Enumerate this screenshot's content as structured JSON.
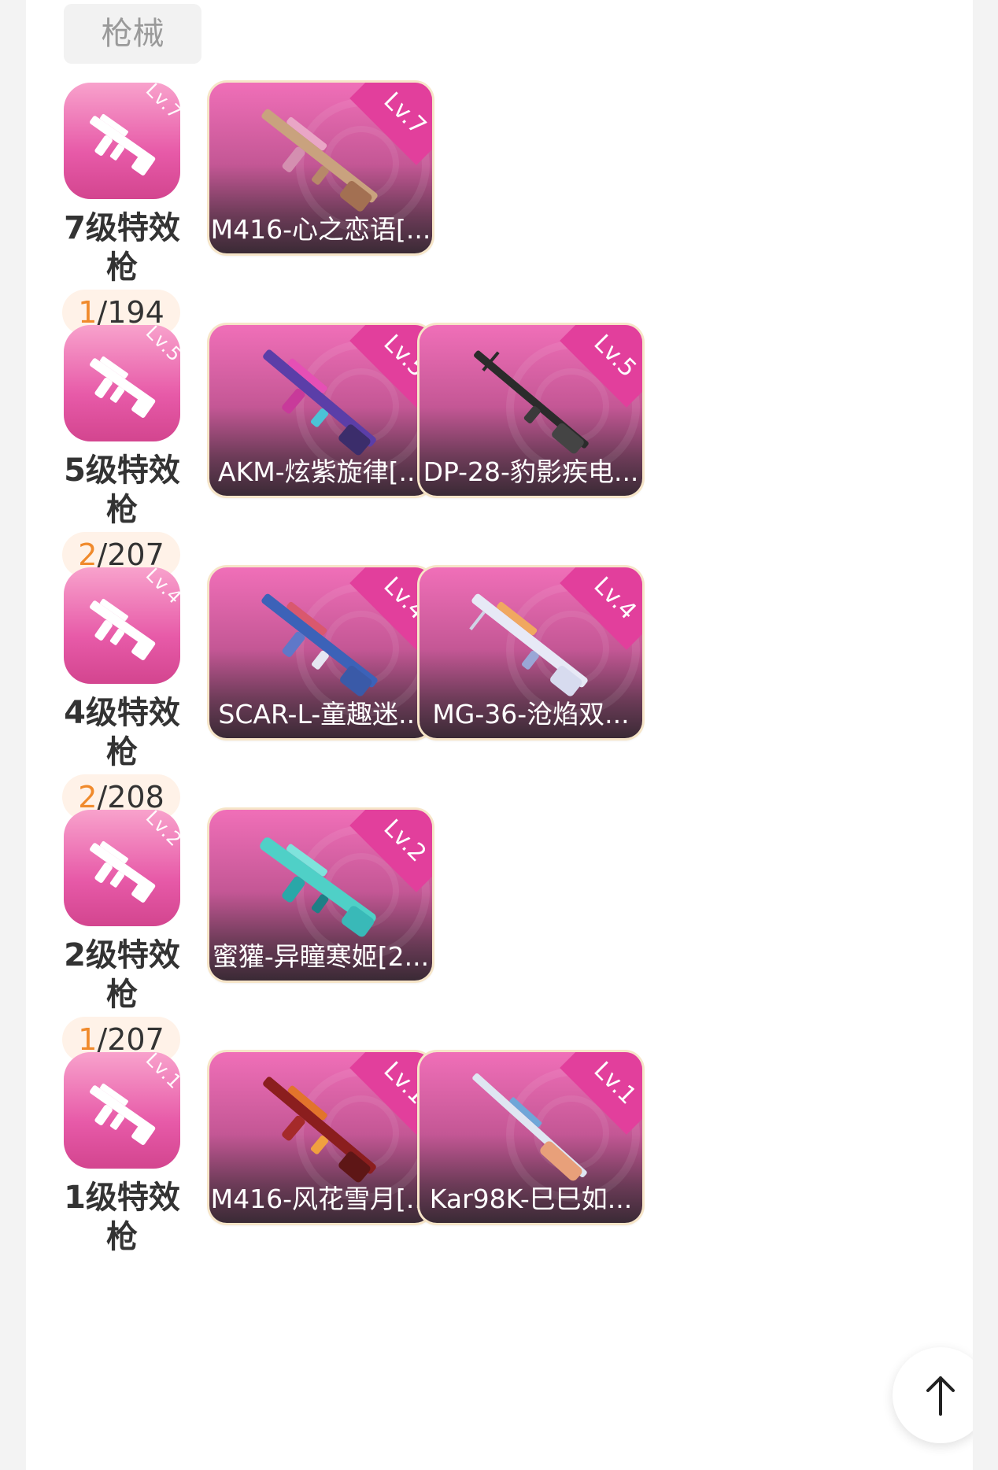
{
  "category": {
    "label": "枪械"
  },
  "tiers": [
    {
      "badge_level": "Lv.7",
      "title": "7级特效枪",
      "count_owned": "1",
      "count_total": "/194",
      "items": [
        {
          "name": "M416-心之恋语[...",
          "level": "Lv.7"
        }
      ]
    },
    {
      "badge_level": "Lv.5",
      "title": "5级特效枪",
      "count_owned": "2",
      "count_total": "/207",
      "items": [
        {
          "name": "AKM-炫紫旋律[...",
          "level": "Lv.5"
        },
        {
          "name": "DP-28-豹影疾电...",
          "level": "Lv.5"
        }
      ]
    },
    {
      "badge_level": "Lv.4",
      "title": "4级特效枪",
      "count_owned": "2",
      "count_total": "/208",
      "items": [
        {
          "name": "SCAR-L-童趣迷...",
          "level": "Lv.4"
        },
        {
          "name": "MG-36-沧焰双...",
          "level": "Lv.4"
        }
      ]
    },
    {
      "badge_level": "Lv.2",
      "title": "2级特效枪",
      "count_owned": "1",
      "count_total": "/207",
      "items": [
        {
          "name": "蜜獾-异瞳寒姬[2...",
          "level": "Lv.2"
        }
      ]
    },
    {
      "badge_level": "Lv.1",
      "title": "1级特效枪",
      "count_owned": "",
      "count_total": "",
      "items": [
        {
          "name": "M416-风花雪月[...",
          "level": "Lv.1"
        },
        {
          "name": "Kar98K-巳巳如...",
          "level": "Lv.1"
        }
      ]
    }
  ],
  "icons": {
    "scroll_top": "arrow-up-icon",
    "badge": "rifle-icon"
  },
  "colors": {
    "accent_orange": "#f08a2c",
    "badge_pink": "#e75aa8",
    "card_border": "#f6e5c8"
  }
}
